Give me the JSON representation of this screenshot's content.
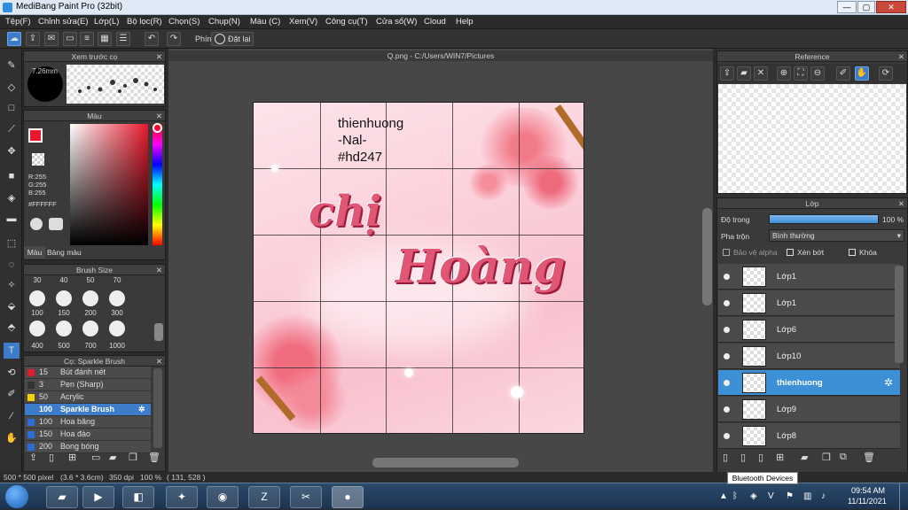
{
  "window": {
    "title": "MediBang Paint Pro (32bit)",
    "min": "—",
    "max": "▢",
    "close": "✕"
  },
  "menu": [
    "Tệp(F)",
    "Chỉnh sửa(E)",
    "Lớp(L)",
    "Bộ lọc(R)",
    "Chọn(S)",
    "Chụp(N)",
    "Màu (C)",
    "Xem(V)",
    "Công cụ(T)",
    "Cửa sổ(W)",
    "Cloud",
    "Help"
  ],
  "toolbar": {
    "shortcut_label": "Phím",
    "reset_label": "Đặt lại"
  },
  "brush_preview": {
    "title": "Xem trước cọ",
    "size": "7.26mm"
  },
  "color_panel": {
    "title": "Màu",
    "r": "R:255",
    "g": "G:255",
    "b": "B:255",
    "hex": "#FFFFFF",
    "tab_color": "Màu",
    "tab_palette": "Bảng màu",
    "fg": "#e8192c",
    "bg": "#ffffff"
  },
  "brush_size": {
    "title": "Brush Size",
    "row1": [
      "30",
      "40",
      "50",
      "70"
    ],
    "row2": [
      "100",
      "150",
      "200",
      "300"
    ],
    "row3": [
      "400",
      "500",
      "700",
      "1000"
    ]
  },
  "brush_list": {
    "title": "Cọ: Sparkle Brush",
    "items": [
      {
        "size": "15",
        "name": "Bút đánh nét",
        "color": "#e8192c"
      },
      {
        "size": "3",
        "name": "Pen (Sharp)",
        "color": "#333333"
      },
      {
        "size": "50",
        "name": "Acrylic",
        "color": "#f5d000"
      },
      {
        "size": "100",
        "name": "Sparkle Brush",
        "color": "#3d7cc9"
      },
      {
        "size": "100",
        "name": "Hoa băng",
        "color": "#2a6ed8"
      },
      {
        "size": "150",
        "name": "Hoa đào",
        "color": "#2a6ed8"
      },
      {
        "size": "200",
        "name": "Bong bóng",
        "color": "#2a6ed8"
      }
    ]
  },
  "document": {
    "tab": "Q.png - C:/Users/WIN7/Pictures"
  },
  "artwork": {
    "line1": "thienhuong",
    "line2": "-Nal-",
    "line3": "#hd247",
    "word1": "chị",
    "word2": "Hoàng"
  },
  "reference": {
    "title": "Reference"
  },
  "layers": {
    "title": "Lớp",
    "opacity_label": "Độ trong",
    "opacity_value": "100 %",
    "opacity_fraction": 1.0,
    "blend_label": "Pha trộn",
    "blend_value": "Bình thường",
    "protect_alpha": "Bảo vệ alpha",
    "clipping": "Xén bớt",
    "lock": "Khóa",
    "items": [
      {
        "name": "Lớp1"
      },
      {
        "name": "Lớp1"
      },
      {
        "name": "Lớp6"
      },
      {
        "name": "Lớp10"
      },
      {
        "name": "thienhuong"
      },
      {
        "name": "Lớp9"
      },
      {
        "name": "Lớp8"
      }
    ]
  },
  "status": {
    "size": "500 * 500 pixel",
    "cm": "(3.6 * 3.6cm)",
    "dpi": "350 dpi",
    "zoom": "100 %",
    "coords": "( 131, 528 )"
  },
  "tooltip": "Bluetooth Devices",
  "clock": {
    "time": "09:54 AM",
    "date": "11/11/2021"
  }
}
